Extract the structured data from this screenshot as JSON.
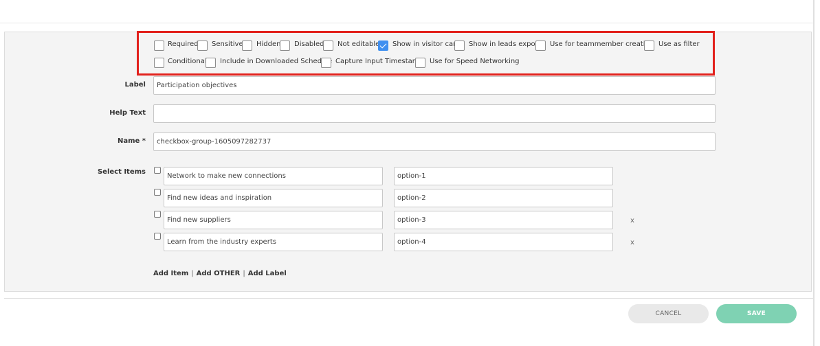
{
  "options": [
    {
      "label": "Required",
      "checked": false
    },
    {
      "label": "Sensitive",
      "checked": false
    },
    {
      "label": "Hidden",
      "checked": false
    },
    {
      "label": "Disabled",
      "checked": false
    },
    {
      "label": "Not editable",
      "checked": false
    },
    {
      "label": "Show in visitor card",
      "checked": true
    },
    {
      "label": "Show in leads export",
      "checked": false
    },
    {
      "label": "Use for teammember creation",
      "checked": false
    },
    {
      "label": "Use as filter",
      "checked": false
    },
    {
      "label": "Conditional",
      "checked": false
    },
    {
      "label": "Include in Downloaded Schedule",
      "checked": false
    },
    {
      "label": "Capture Input Timestamp",
      "checked": false
    },
    {
      "label": "Use for Speed Networking",
      "checked": false
    }
  ],
  "fields": {
    "label": {
      "label": "Label",
      "value": "Participation objectives"
    },
    "help_text": {
      "label": "Help Text",
      "value": ""
    },
    "name": {
      "label": "Name *",
      "value": "checkbox-group-1605097282737"
    }
  },
  "select_items": {
    "label": "Select Items",
    "items": [
      {
        "text": "Network to make new connections",
        "value": "option-1",
        "removable": false
      },
      {
        "text": "Find new ideas and inspiration",
        "value": "option-2",
        "removable": false
      },
      {
        "text": "Find new suppliers",
        "value": "option-3",
        "removable": true
      },
      {
        "text": "Learn from the industry experts",
        "value": "option-4",
        "removable": true
      }
    ],
    "remove_symbol": "x"
  },
  "links": {
    "add_item": "Add Item",
    "add_other": "Add OTHER",
    "add_label": "Add Label",
    "separator": "|"
  },
  "buttons": {
    "cancel": "CANCEL",
    "save": "SAVE"
  },
  "colors": {
    "highlight": "#e2211c",
    "checkbox_checked": "#3f8ff0",
    "save_button": "#7fd2b3"
  }
}
